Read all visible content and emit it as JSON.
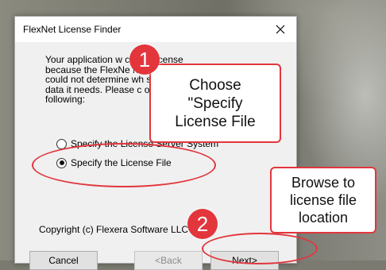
{
  "dialog": {
    "title": "FlexNet License Finder",
    "close_glyph": "✕",
    "body_text": "Your application w            cate a license\nbecause the FlexNe           nment\ncould not determine wh          server for the\ndata it needs.  Please c          of the\nfollowing:",
    "options": [
      {
        "label": "Specify the License Server System",
        "checked": false
      },
      {
        "label": "Specify the License File",
        "checked": true
      }
    ],
    "copyright": "Copyright (c) Flexera Software LLC",
    "buttons": {
      "cancel": "Cancel",
      "back": "<Back",
      "next": "Next>"
    }
  },
  "annotations": {
    "badge_1": "1",
    "badge_2": "2",
    "callout_1": "Choose\n\"Specify\nLicense File",
    "callout_2": "Browse to\nlicense file\nlocation",
    "accent_color": "#e2363c"
  }
}
